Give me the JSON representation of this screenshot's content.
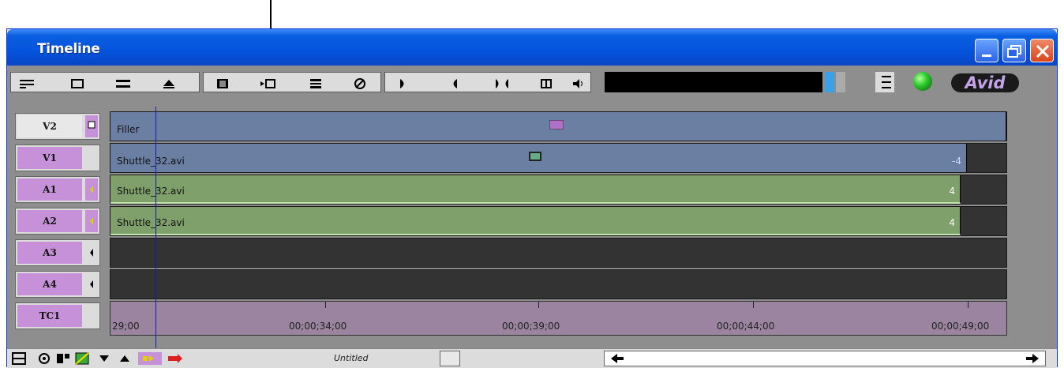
{
  "window": {
    "title": "Timeline"
  },
  "branding": {
    "logo": "Avid"
  },
  "tracks": [
    {
      "label": "V2"
    },
    {
      "label": "V1"
    },
    {
      "label": "A1"
    },
    {
      "label": "A2"
    },
    {
      "label": "A3"
    },
    {
      "label": "A4"
    },
    {
      "label": "TC1"
    }
  ],
  "clips": [
    {
      "name": "Filler",
      "end": ""
    },
    {
      "name": "Shuttle_32.avi",
      "end": "-4"
    },
    {
      "name": "Shuttle_32.avi",
      "end": "4"
    },
    {
      "name": "Shuttle_32.avi",
      "end": "4"
    }
  ],
  "ruler": {
    "timecodes": [
      "29;00",
      "00;00;34;00",
      "00;00;39;00",
      "00;00;44;00",
      "00;00;49;00"
    ]
  },
  "status": {
    "sequence_name": "Untitled"
  },
  "colors": {
    "video_clip": "#6b7fa3",
    "audio_clip": "#7fa06a",
    "track_selected": "#c691d9",
    "titlebar": "#0554dd"
  }
}
